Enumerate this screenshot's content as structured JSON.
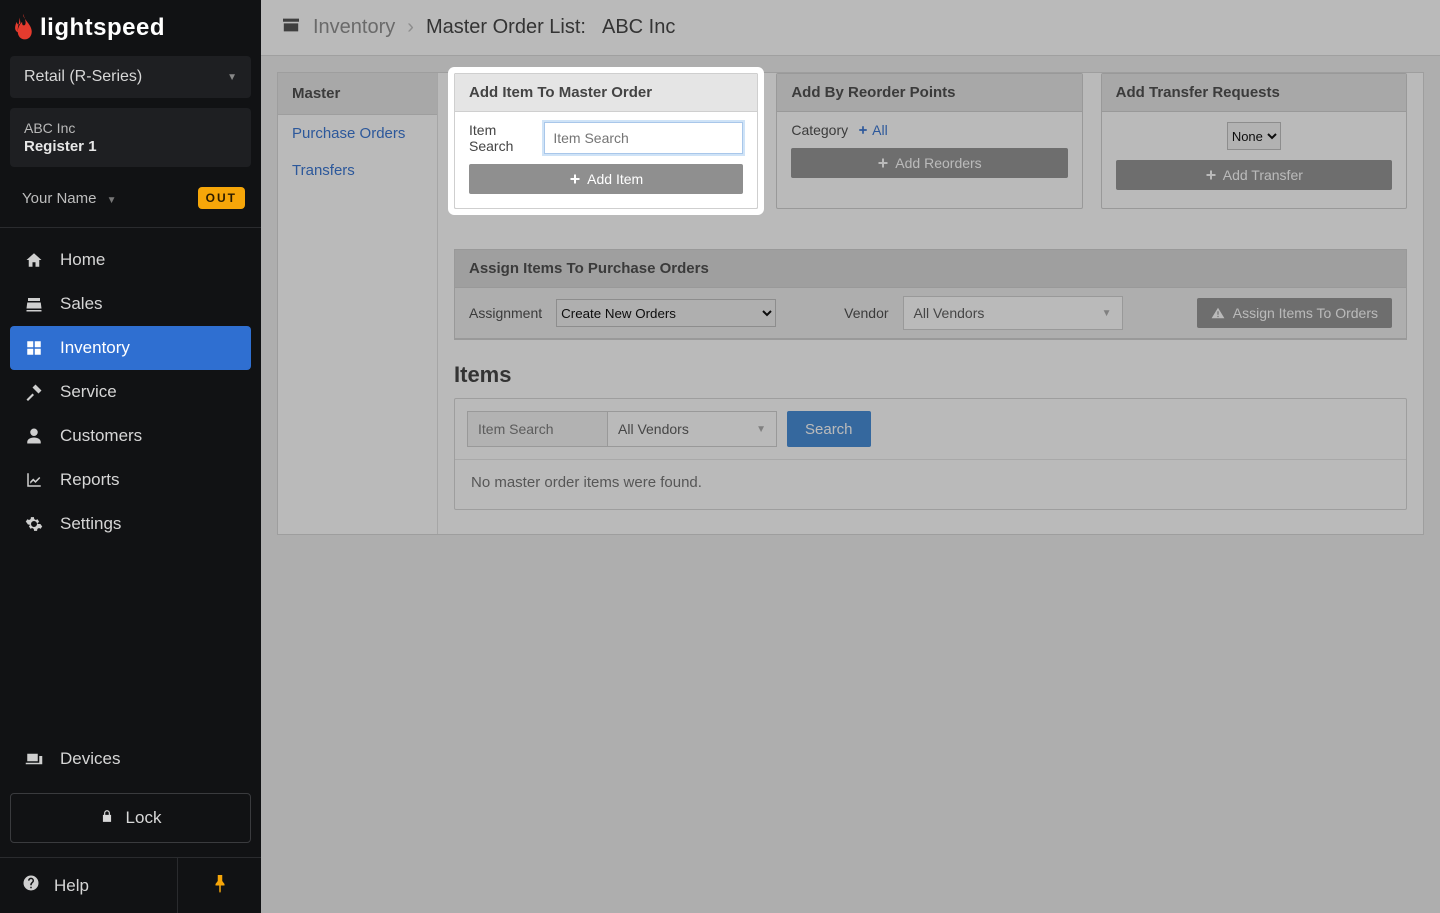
{
  "brand": "lightspeed",
  "product_selector": "Retail (R-Series)",
  "company": {
    "name": "ABC Inc",
    "register": "Register 1"
  },
  "user": {
    "name": "Your Name",
    "badge": "OUT"
  },
  "nav": {
    "home": "Home",
    "sales": "Sales",
    "inventory": "Inventory",
    "service": "Service",
    "customers": "Customers",
    "reports": "Reports",
    "settings": "Settings",
    "devices": "Devices"
  },
  "lock_label": "Lock",
  "help_label": "Help",
  "breadcrumb": {
    "root": "Inventory",
    "page": "Master Order List:",
    "entity": "ABC Inc"
  },
  "subnav": {
    "header": "Master",
    "purchase_orders": "Purchase Orders",
    "transfers": "Transfers"
  },
  "card_add_item": {
    "title": "Add Item To Master Order",
    "field_label": "Item Search",
    "placeholder": "Item Search",
    "button": "Add Item"
  },
  "card_reorder": {
    "title": "Add By Reorder Points",
    "field_label": "Category",
    "all_link": "All",
    "button": "Add Reorders"
  },
  "card_transfer": {
    "title": "Add Transfer Requests",
    "select_value": "None",
    "button": "Add Transfer"
  },
  "assign": {
    "title": "Assign Items To Purchase Orders",
    "assignment_label": "Assignment",
    "assignment_value": "Create New Orders",
    "vendor_label": "Vendor",
    "vendor_value": "All Vendors",
    "button": "Assign Items To Orders"
  },
  "items": {
    "heading": "Items",
    "search_placeholder": "Item Search",
    "vendor_value": "All Vendors",
    "search_button": "Search",
    "empty_msg": "No master order items were found."
  }
}
